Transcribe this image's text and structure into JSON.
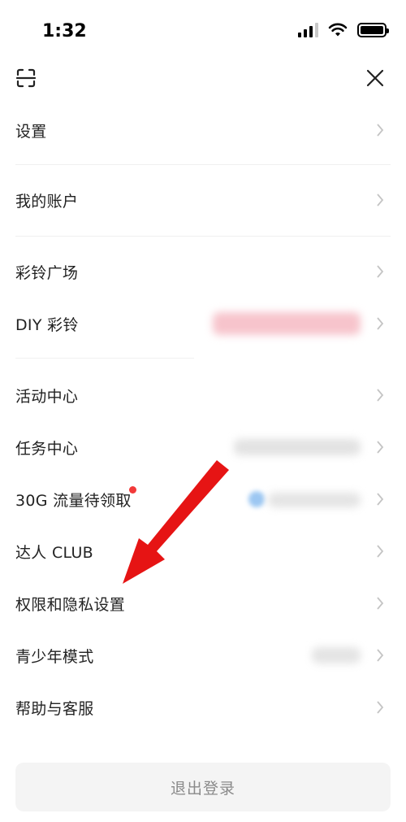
{
  "status_bar": {
    "time": "1:32"
  },
  "header": {
    "scan_icon": "scan-icon",
    "close_icon": "close-icon"
  },
  "menu": {
    "items": [
      {
        "label": "设置"
      },
      {
        "label": "我的账户"
      },
      {
        "label": "彩铃广场"
      },
      {
        "label": "DIY 彩铃"
      },
      {
        "label": "活动中心"
      },
      {
        "label": "任务中心"
      },
      {
        "label": "30G 流量待领取"
      },
      {
        "label": "达人 CLUB"
      },
      {
        "label": "权限和隐私设置"
      },
      {
        "label": "青少年模式"
      },
      {
        "label": "帮助与客服"
      }
    ]
  },
  "logout": {
    "label": "退出登录"
  },
  "colors": {
    "badge_red": "#f23a3a",
    "arrow_red": "#e61414",
    "button_bg": "#f4f4f4"
  }
}
